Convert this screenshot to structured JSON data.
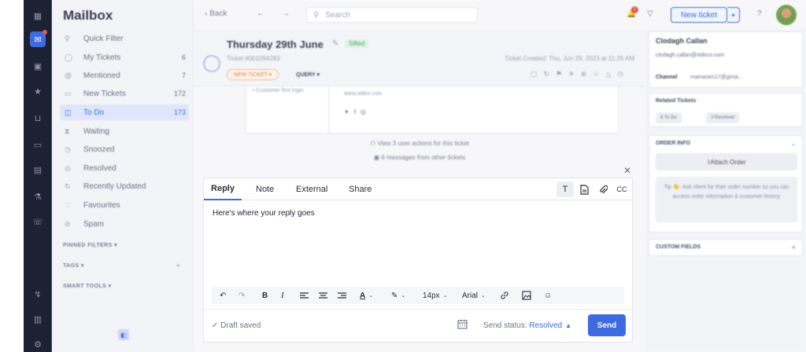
{
  "sidebar": {
    "title": "Mailbox",
    "items": [
      {
        "label": "Quick Filter",
        "count": ""
      },
      {
        "label": "My Tickets",
        "count": "6"
      },
      {
        "label": "Mentioned",
        "count": "7"
      },
      {
        "label": "New Tickets",
        "count": "172"
      },
      {
        "label": "To Do",
        "count": "173"
      },
      {
        "label": "Waiting",
        "count": ""
      },
      {
        "label": "Snoozed",
        "count": ""
      },
      {
        "label": "Resolved",
        "count": ""
      },
      {
        "label": "Recently Updated",
        "count": ""
      },
      {
        "label": "Favourites",
        "count": ""
      },
      {
        "label": "Spam",
        "count": ""
      }
    ],
    "sections": [
      "PINNED FILTERS",
      "TAGS",
      "SMART TOOLS"
    ]
  },
  "topbar": {
    "back_label": "Back",
    "search_placeholder": "Search",
    "new_ticket_label": "New ticket",
    "notification_count": "1"
  },
  "ticket": {
    "title": "Thursday 29th June",
    "badge": "Sifted",
    "ticket_id": "Ticket #001094283",
    "created": "Ticket Created: Thu, Jun 29, 2023 at 11:26 AM",
    "status_pill": "NEW TICKET",
    "type": "QUERY",
    "email_left": "• Customer first login",
    "email_right": "www.sideo.com",
    "user_actions": "View 3 user actions for this ticket",
    "other_messages": "6 messages from other tickets"
  },
  "editor": {
    "tabs": [
      "Reply",
      "Note",
      "External",
      "Share"
    ],
    "tools_right": [
      "T",
      "CC"
    ],
    "body": "Here's where your reply goes",
    "font_size": "14px",
    "font_name": "Arial",
    "draft_status": "Draft saved",
    "send_status_label": "Send status:",
    "send_status_value": "Resolved",
    "send_label": "Send"
  },
  "customer": {
    "name": "Clodagh Callan",
    "email": "clodagh.callan@sideco.com",
    "channel_label": "Channel",
    "channel_value": "mamasen17@gmai...",
    "related_title": "Related Tickets",
    "related_chips": [
      "6 To Do",
      "3 Resolved"
    ],
    "order_title": "ORDER INFO",
    "attach_label": "Attach Order",
    "tip": "Tip 👋: Ask client for their order number so you can access order information & customer history",
    "custom_title": "CUSTOM FIELDS"
  },
  "colors": {
    "accent": "#3e6be0",
    "rail": "#1c2233",
    "badge_red": "#e05b4b"
  }
}
